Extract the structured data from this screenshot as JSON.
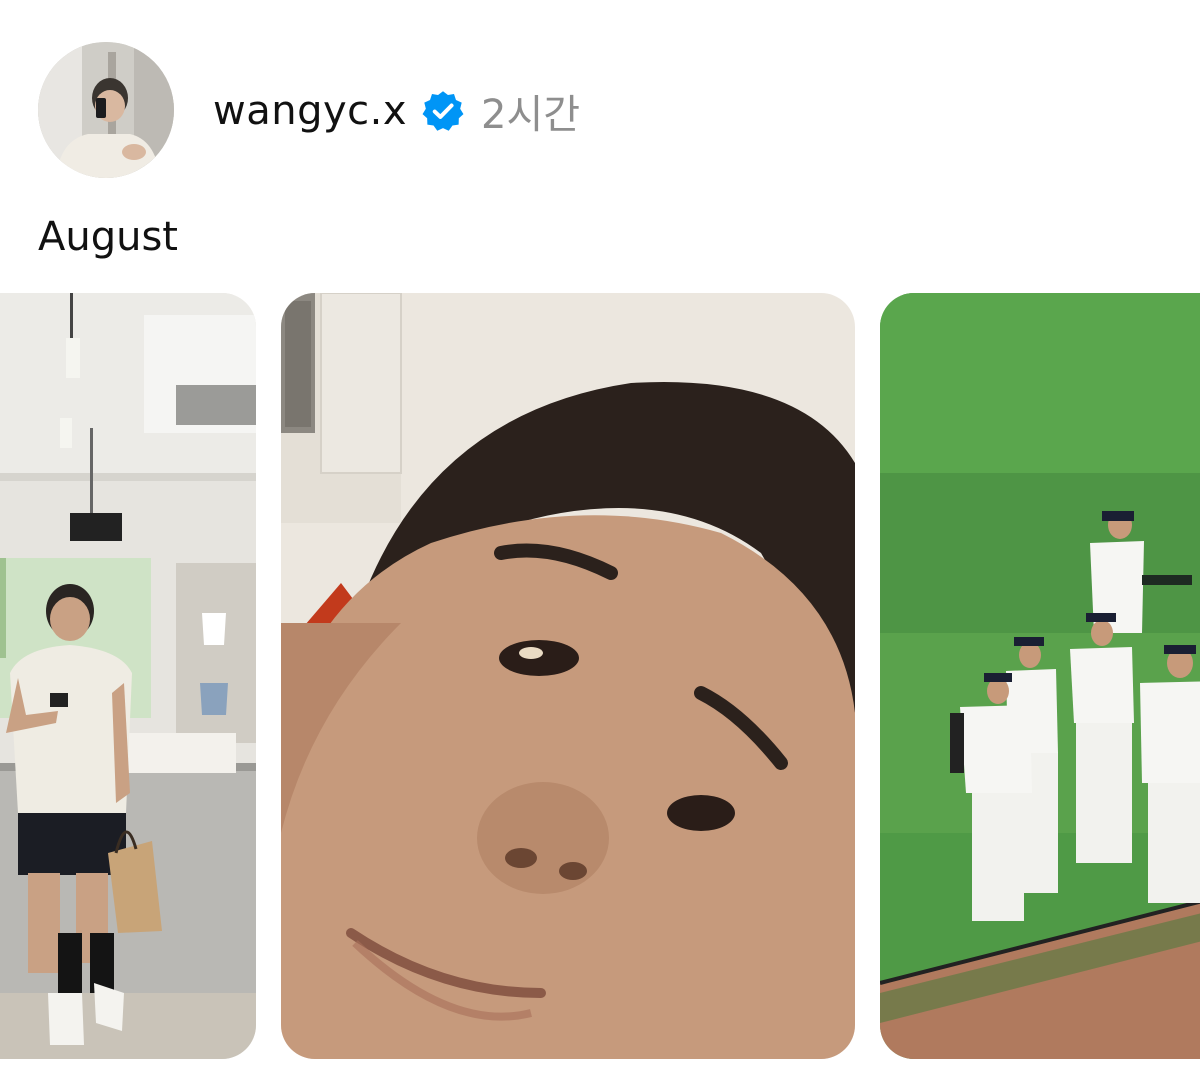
{
  "post": {
    "username": "wangyc.x",
    "verified": true,
    "timestamp": "2시간",
    "caption": "August"
  },
  "icons": {
    "verified": "verified-badge-icon"
  },
  "colors": {
    "verified_blue": "#0095f6",
    "timestamp_gray": "#8e8e8e",
    "text": "#111111"
  },
  "photos": [
    {
      "id": "photo-1"
    },
    {
      "id": "photo-2"
    },
    {
      "id": "photo-3"
    }
  ]
}
